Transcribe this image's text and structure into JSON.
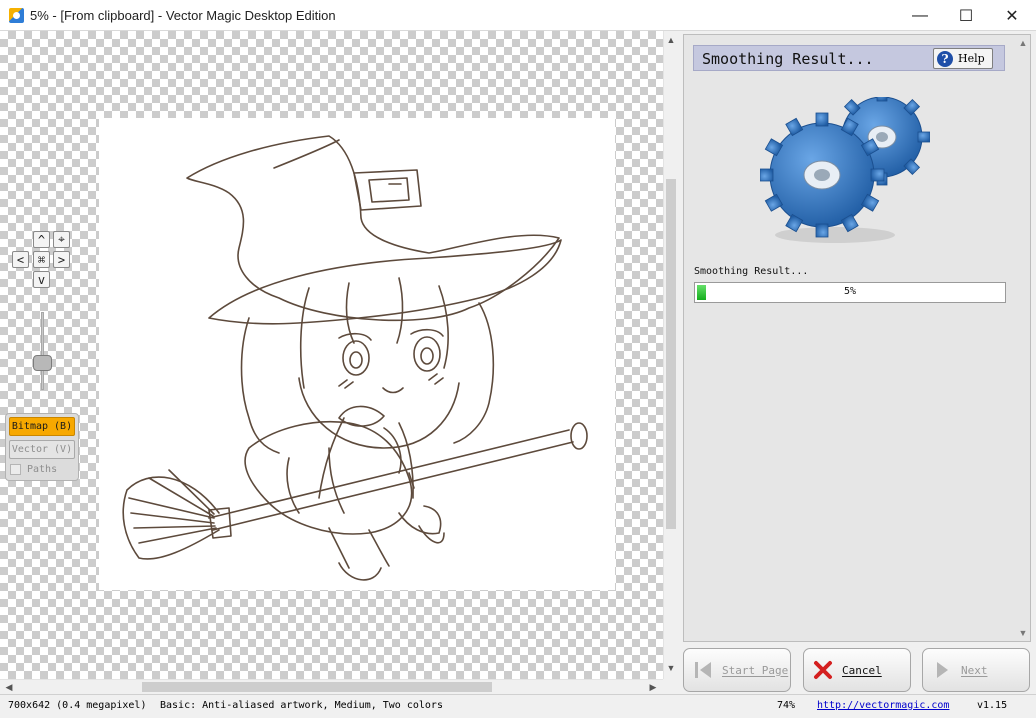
{
  "window": {
    "title": "5% - [From clipboard] - Vector Magic Desktop Edition",
    "minimize": "—",
    "maximize": "☐",
    "close": "✕"
  },
  "nav": {
    "up": "^",
    "down": "v",
    "left": "<",
    "right": ">",
    "center": "⌘",
    "fit": "⌖",
    "zoom_level": 0.7
  },
  "view": {
    "bitmap_label": "Bitmap (B)",
    "vector_label": "Vector (V)",
    "paths_label": "Paths"
  },
  "panel": {
    "title": "Smoothing Result...",
    "help_label": "Help",
    "progress_label": "Smoothing Result...",
    "progress_text": "5%",
    "progress_value": 5
  },
  "buttons": {
    "start_page": "Start Page",
    "cancel": "Cancel",
    "next": "Next"
  },
  "status": {
    "image_size": "700x642 (0.4 megapixel)",
    "settings": "Basic: Anti-aliased artwork, Medium, Two colors",
    "zoom": "74%",
    "link": "http://vectormagic.com",
    "version": "v1.15"
  },
  "icons": [
    "app-icon",
    "help-icon",
    "gears-icon",
    "start-page-icon",
    "cancel-icon",
    "next-icon"
  ],
  "colors": {
    "accent_bitmap": "#f7a800",
    "panel_header": "#c5c8df",
    "progress": "#14ad1c",
    "gear": "#2f6fb5",
    "cancel_x": "#d42020"
  }
}
